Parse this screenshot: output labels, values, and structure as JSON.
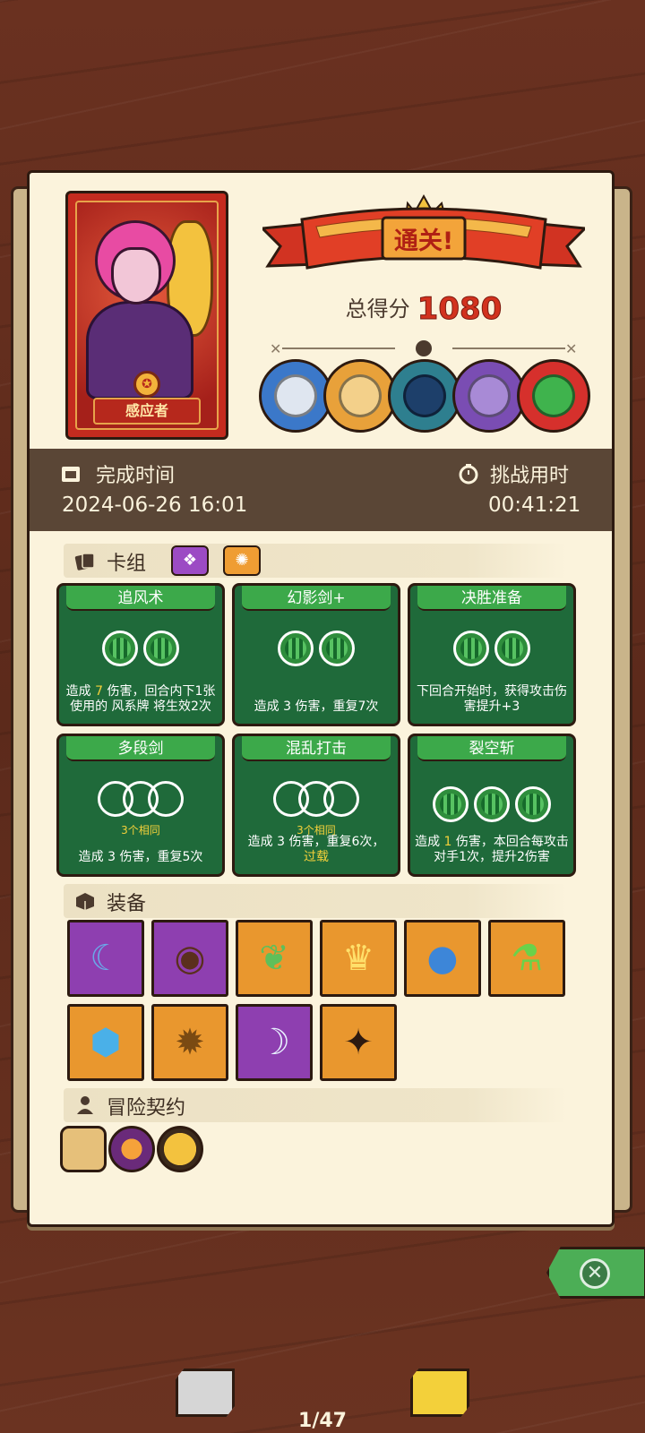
{
  "character": {
    "name": "感应者"
  },
  "result": {
    "banner": "通关!",
    "score_label": "总得分",
    "score": "1080"
  },
  "bosses": [
    {
      "icon": "mushroom-sage-icon",
      "color": "#3b78c9"
    },
    {
      "icon": "lion-king-icon",
      "color": "#e8a13a"
    },
    {
      "icon": "armored-knight-icon",
      "color": "#2e7f8f"
    },
    {
      "icon": "purple-dragon-icon",
      "color": "#7a4db3"
    },
    {
      "icon": "rainbow-beast-icon",
      "color": "#d6302c"
    }
  ],
  "stats": {
    "finish_label": "完成时间",
    "finish_value": "2024-06-26 16:01",
    "challenge_label": "挑战用时",
    "challenge_value": "00:41:21"
  },
  "deck": {
    "title": "卡组",
    "tags": [
      {
        "icon": "purple-rune-icon",
        "color": "#9c4bc4"
      },
      {
        "icon": "orange-swirl-icon",
        "color": "#ef9d33"
      }
    ],
    "cards": [
      {
        "title": "追风术",
        "orbs": 2,
        "sub": "",
        "desc": [
          "造成 ",
          "7",
          " 伤害，回合内下1张使用的 ",
          "风系牌 将生效2次"
        ]
      },
      {
        "title": "幻影剑+",
        "orbs": 2,
        "sub": "",
        "desc": [
          "造成 ",
          "3",
          " 伤害，重复7次"
        ]
      },
      {
        "title": "决胜准备",
        "orbs": 2,
        "sub": "",
        "desc": [
          "下回合开始时，获得攻击伤害提升+3"
        ]
      },
      {
        "title": "多段剑",
        "orbs": 3,
        "sub": "3个相同",
        "desc": [
          "造成 ",
          "3",
          " 伤害，重复5次"
        ]
      },
      {
        "title": "混乱打击",
        "orbs": 3,
        "sub": "3个相同",
        "desc": [
          "造成 ",
          "3",
          " 伤害，重复6次，",
          "过载"
        ]
      },
      {
        "title": "裂空斩",
        "orbs": 3,
        "sub": "",
        "desc": [
          "造成 ",
          "1",
          " 伤害，本回合每攻击对手1次，提升2伤害"
        ]
      }
    ]
  },
  "equipment": {
    "title": "装备",
    "items": [
      {
        "icon": "crescent-blade-icon",
        "rarity": "purple",
        "glyph": "☾"
      },
      {
        "icon": "wooden-shield-icon",
        "rarity": "purple",
        "glyph": "◉"
      },
      {
        "icon": "green-feather-icon",
        "rarity": "orange",
        "glyph": "❦"
      },
      {
        "icon": "golden-crown-icon",
        "rarity": "orange",
        "glyph": "♛"
      },
      {
        "icon": "blue-slime-icon",
        "rarity": "orange",
        "glyph": "●"
      },
      {
        "icon": "green-potion-icon",
        "rarity": "orange",
        "glyph": "⚗"
      },
      {
        "icon": "blue-crest-icon",
        "rarity": "orange",
        "glyph": "⬢"
      },
      {
        "icon": "golden-emblem-icon",
        "rarity": "orange",
        "glyph": "✹"
      },
      {
        "icon": "curved-dagger-icon",
        "rarity": "purple",
        "glyph": "☽"
      },
      {
        "icon": "dark-cloak-icon",
        "rarity": "orange",
        "glyph": "✦"
      }
    ]
  },
  "contracts": {
    "title": "冒险契约",
    "items": [
      {
        "icon": "scroll-icon"
      },
      {
        "icon": "campfire-icon"
      },
      {
        "icon": "gold-coin-icon"
      }
    ]
  },
  "pager": {
    "text": "1/47"
  },
  "colors": {
    "paper": "#fbf3dc",
    "red": "#d2321e",
    "green": "#1f6a3a",
    "purple": "#8e3fb0",
    "orange": "#e9972e"
  }
}
